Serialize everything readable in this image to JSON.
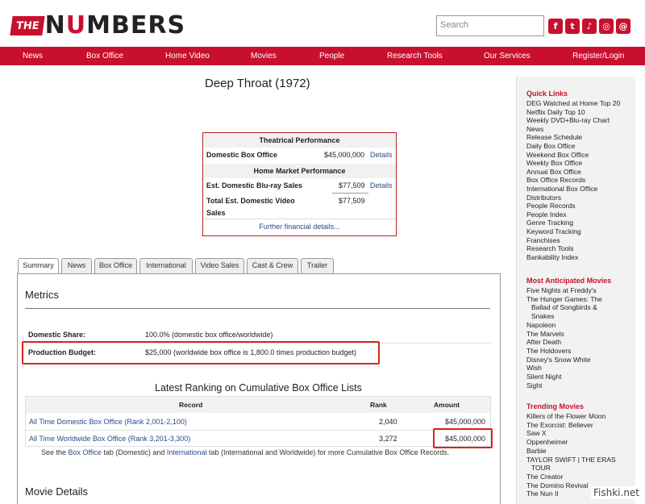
{
  "header": {
    "logo_the": "THE",
    "logo_n": "N",
    "logo_u": "U",
    "logo_rest": "MBERS",
    "search_placeholder": "Search",
    "social": [
      "f",
      "t",
      "♪",
      "◎",
      "@"
    ]
  },
  "nav": [
    "News",
    "Box Office",
    "Home Video",
    "Movies",
    "People",
    "Research Tools",
    "Our Services",
    "Register/Login"
  ],
  "page_title": "Deep Throat (1972)",
  "financial": {
    "theatrical_header": "Theatrical Performance",
    "domestic_label": "Domestic Box Office",
    "domestic_value": "$45,000,000",
    "domestic_link": "Details",
    "home_header": "Home Market Performance",
    "bluray_label": "Est. Domestic Blu-ray Sales",
    "bluray_value": "$77,509",
    "bluray_link": "Details",
    "video_label_1": "Total Est. Domestic Video",
    "video_label_2": "Sales",
    "video_value": "$77,509",
    "footer_link": "Further financial details..."
  },
  "tabs": [
    "Summary",
    "News",
    "Box Office",
    "International",
    "Video Sales",
    "Cast & Crew",
    "Trailer"
  ],
  "metrics": {
    "heading": "Metrics",
    "share_label": "Domestic Share:",
    "share_value": "100.0% (domestic box office/worldwide)",
    "budget_label": "Production Budget:",
    "budget_value": "$25,000 (worldwide box office is 1,800.0 times production budget)"
  },
  "ranking": {
    "heading": "Latest Ranking on Cumulative Box Office Lists",
    "columns": [
      "Record",
      "Rank",
      "Amount"
    ],
    "rows": [
      {
        "record": "All Time Domestic Box Office (Rank 2,001-2,100)",
        "rank": "2,040",
        "amount": "$45,000,000"
      },
      {
        "record": "All Time Worldwide Box Office (Rank 3,201-3,300)",
        "rank": "3,272",
        "amount": "$45,000,000"
      }
    ],
    "note_1": "See the ",
    "note_link_1": "Box Office",
    "note_2": " tab (Domestic) and ",
    "note_link_2": "International",
    "note_3": " tab (International and Worldwide) for more Cumulative Box Office Records."
  },
  "details_heading": "Movie Details",
  "sidebar": {
    "quick_links_heading": "Quick Links",
    "quick_links": [
      "DEG Watched at Home Top 20",
      "Netflix Daily Top 10",
      "Weekly DVD+Blu-ray Chart",
      "News",
      "Release Schedule",
      "Daily Box Office",
      "Weekend Box Office",
      "Weekly Box Office",
      "Annual Box Office",
      "Box Office Records",
      "International Box Office",
      "Distributors",
      "People Records",
      "People Index",
      "Genre Tracking",
      "Keyword Tracking",
      "Franchises",
      "Research Tools",
      "Bankability Index"
    ],
    "anticipated_heading": "Most Anticipated Movies",
    "anticipated": [
      "Five Nights at Freddy's",
      "The Hunger Games: The",
      "Ballad of Songbirds &",
      "Snakes",
      "Napoleon",
      "The Marvels",
      "After Death",
      "The Holdovers",
      "Disney's Snow White",
      "Wish",
      "Silent Night",
      "Sight"
    ],
    "trending_heading": "Trending Movies",
    "trending": [
      "Killers of the Flower Moon",
      "The Exorcist: Believer",
      "Saw X",
      "Oppenheimer",
      "Barbie",
      "TAYLOR SWIFT | THE ERAS",
      "TOUR",
      "The Creator",
      "The Domino Revival",
      "The Nun II"
    ]
  },
  "watermark": "Fishki.net",
  "colors": {
    "brand_red": "#c8102e",
    "highlight_red": "#d9261c",
    "link_blue": "#2a4a8a"
  }
}
